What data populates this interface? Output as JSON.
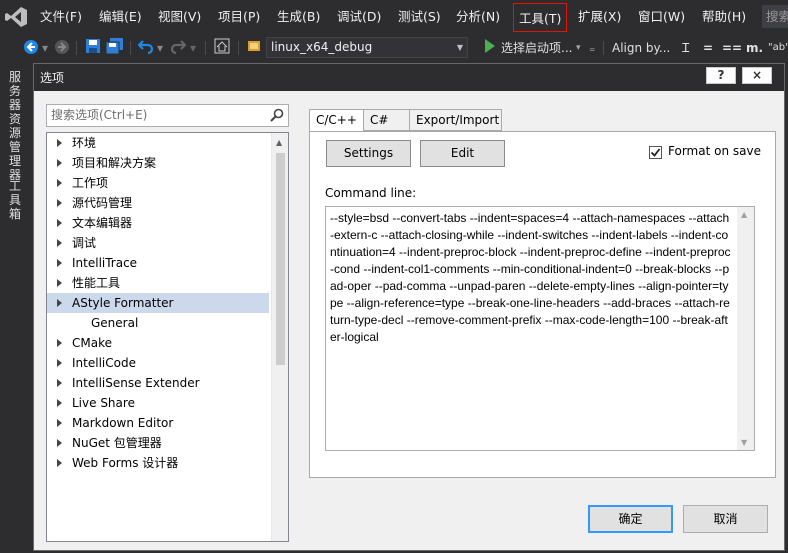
{
  "menu": {
    "items": [
      "文件(F)",
      "编辑(E)",
      "视图(V)",
      "项目(P)",
      "生成(B)",
      "调试(D)",
      "测试(S)",
      "分析(N)",
      "工具(T)",
      "扩展(X)",
      "窗口(W)",
      "帮助(H)"
    ],
    "active_item": "工具(T)",
    "search_placeholder": "搜索"
  },
  "toolbar": {
    "configuration": "linux_x64_debug",
    "start_item": "选择启动项...",
    "align_label": "Align by...",
    "icon_names": [
      "back-icon",
      "forward-icon",
      "save-icon",
      "save-all-icon",
      "undo-icon",
      "redo-icon",
      "home-icon",
      "config-icon",
      "start-icon"
    ]
  },
  "side_strip": {
    "server_explorer": "服务器资源管理器",
    "toolbox": "工具箱"
  },
  "dialog": {
    "title": "选项",
    "help_button": "?",
    "close_button": "×",
    "search_placeholder": "搜索选项(Ctrl+E)",
    "tree": [
      {
        "label": "环境",
        "expandable": true
      },
      {
        "label": "项目和解决方案",
        "expandable": true
      },
      {
        "label": "工作项",
        "expandable": true
      },
      {
        "label": "源代码管理",
        "expandable": true
      },
      {
        "label": "文本编辑器",
        "expandable": true
      },
      {
        "label": "调试",
        "expandable": true
      },
      {
        "label": "IntelliTrace",
        "expandable": true
      },
      {
        "label": "性能工具",
        "expandable": true
      },
      {
        "label": "AStyle Formatter",
        "expandable": true,
        "selected": true
      },
      {
        "label": "General",
        "child": true
      },
      {
        "label": "CMake",
        "expandable": true
      },
      {
        "label": "IntelliCode",
        "expandable": true
      },
      {
        "label": "IntelliSense Extender",
        "expandable": true
      },
      {
        "label": "Live Share",
        "expandable": true
      },
      {
        "label": "Markdown Editor",
        "expandable": true
      },
      {
        "label": "NuGet 包管理器",
        "expandable": true
      },
      {
        "label": "Web Forms 设计器",
        "expandable": true
      }
    ],
    "tabs": [
      "C/C++",
      "C#",
      "Export/Import"
    ],
    "active_tab": "C/C++",
    "settings_button": "Settings",
    "edit_button": "Edit",
    "format_on_save_label": "Format on save",
    "format_on_save_checked": true,
    "command_line_label": "Command line:",
    "command_line": "--style=bsd --convert-tabs --indent=spaces=4 --attach-namespaces --attach-extern-c --attach-closing-while --indent-switches --indent-labels --indent-continuation=4 --indent-preproc-block --indent-preproc-define --indent-preproc-cond --indent-col1-comments --min-conditional-indent=0 --break-blocks --pad-oper --pad-comma --unpad-paren --delete-empty-lines --align-pointer=type --align-reference=type --break-one-line-headers --add-braces --attach-return-type-decl --remove-comment-prefix --max-code-length=100 --break-after-logical",
    "ok_button": "确定",
    "cancel_button": "取消"
  },
  "colors": {
    "ide_background": "#2d2d30",
    "menu_highlight_border": "#e51400",
    "tree_selection": "#ccd8ec",
    "default_button_border": "#3399ff"
  }
}
